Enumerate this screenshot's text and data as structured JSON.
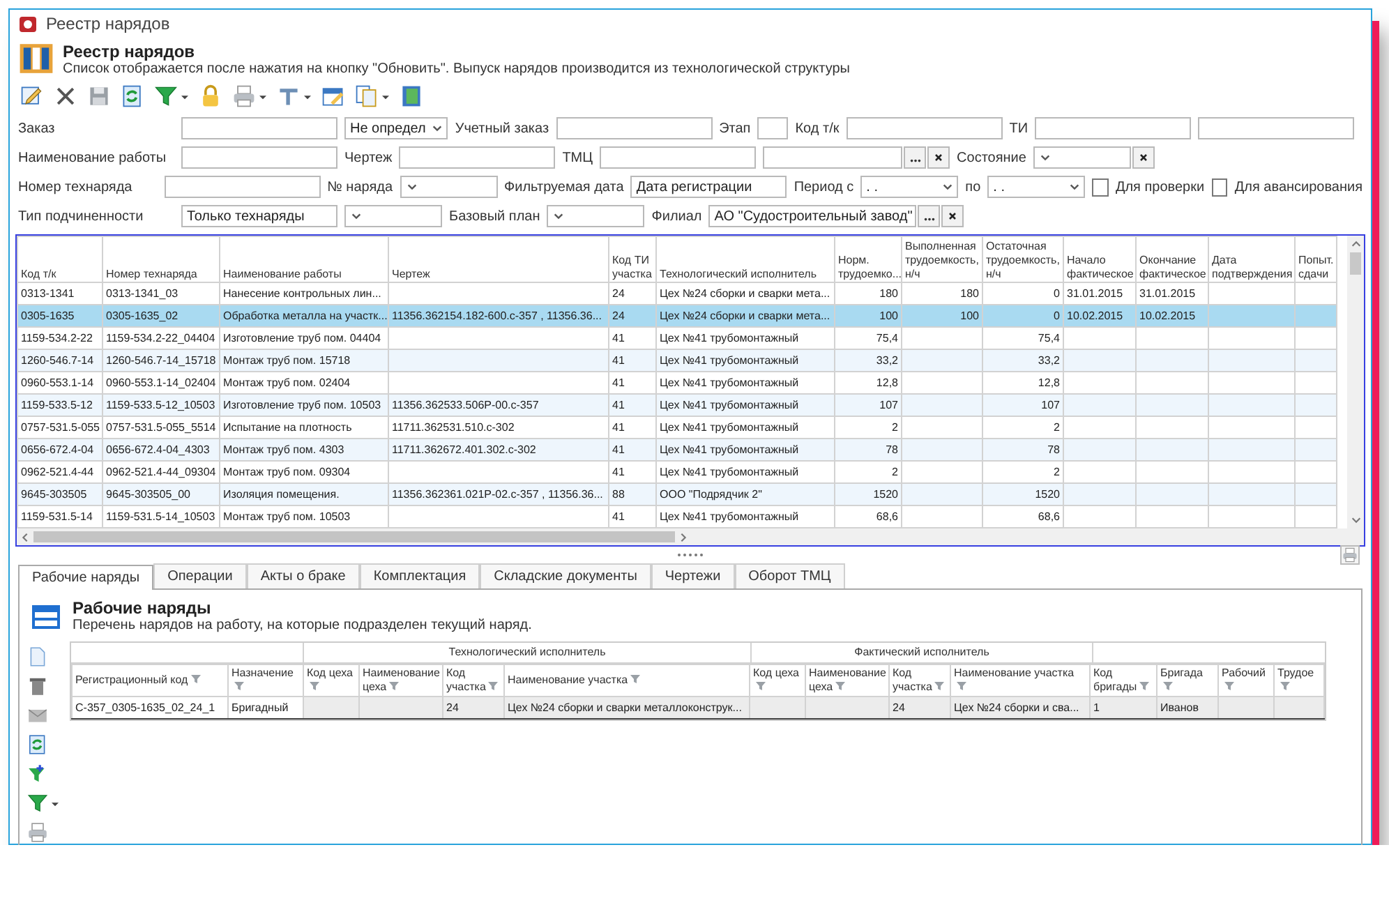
{
  "window": {
    "title": "Реестр нарядов"
  },
  "header": {
    "title": "Реестр нарядов",
    "subtitle": "Список отображается после нажатия на кнопку \"Обновить\". Выпуск нарядов производится из технологической структуры"
  },
  "filters": [
    [
      {
        "kind": "field",
        "label": "Заказ"
      },
      {
        "kind": "combo",
        "value": "Не определ"
      },
      {
        "kind": "field",
        "label": "Учетный заказ"
      },
      {
        "kind": "short",
        "label": "Этап"
      },
      {
        "kind": "field",
        "label": "Код т/к"
      },
      {
        "kind": "field",
        "label": "ТИ"
      },
      {
        "kind": "field"
      }
    ],
    [
      {
        "kind": "field",
        "label": "Наименование работы"
      },
      {
        "kind": "field",
        "label": "Чертеж"
      },
      {
        "kind": "field",
        "label": "ТМЦ"
      },
      {
        "kind": "lookup"
      },
      {
        "kind": "combo-clear",
        "label": "Состояние"
      }
    ],
    [
      {
        "kind": "field",
        "label": "Номер технаряда"
      },
      {
        "kind": "combo",
        "label": "№ наряда"
      },
      {
        "kind": "field",
        "label": "Фильтруемая дата",
        "value": "Дата регистрации"
      },
      {
        "kind": "combo",
        "label": "Период с",
        "value": ". ."
      },
      {
        "kind": "combo",
        "label": "по",
        "value": ". ."
      },
      {
        "kind": "check",
        "label": "Для проверки",
        "checked": false
      },
      {
        "kind": "check",
        "label": "Для авансирования",
        "checked": false
      }
    ],
    [
      {
        "kind": "field",
        "label": "Тип подчиненности",
        "value": "Только технаряды"
      },
      {
        "kind": "combo"
      },
      {
        "kind": "combo",
        "label": "Базовый план"
      },
      {
        "kind": "lookup",
        "label": "Филиал",
        "value": "АО \"Судостроительный завод\""
      }
    ]
  ],
  "grid": {
    "columns": [
      "Код т/к",
      "Номер технаряда",
      "Наименование работы",
      "Чертеж",
      "Код ТИ участка",
      "Технологический исполнитель",
      "Норм. трудоемко...",
      "Выполненная трудоемкость, н/ч",
      "Остаточная трудоемкость, н/ч",
      "Начало фактическое",
      "Окончание фактическое",
      "Дата подтверждения",
      "Попыт. сдачи"
    ],
    "rows": [
      {
        "selected": false,
        "cells": [
          "0313-1341",
          "0313-1341_03",
          "Нанесение контрольных лин...",
          null,
          "24",
          "Цех №24 сборки и сварки мета...",
          "180",
          "180",
          "0",
          "31.01.2015",
          "31.01.2015",
          null,
          null
        ]
      },
      {
        "selected": true,
        "cells": [
          "0305-1635",
          "0305-1635_02",
          "Обработка металла на участк...",
          "11356.362154.182-600.с-357 , 11356.36...",
          "24",
          "Цех №24 сборки и сварки мета...",
          "100",
          "100",
          "0",
          "10.02.2015",
          "10.02.2015",
          null,
          null
        ]
      },
      {
        "selected": false,
        "cells": [
          "1159-534.2-22",
          "1159-534.2-22_04404",
          "Изготовление труб пом. 04404",
          null,
          "41",
          "Цех №41 трубомонтажный",
          "75,4",
          null,
          "75,4",
          null,
          null,
          null,
          null
        ]
      },
      {
        "selected": false,
        "cells": [
          "1260-546.7-14",
          "1260-546.7-14_15718",
          "Монтаж труб пом. 15718",
          null,
          "41",
          "Цех №41 трубомонтажный",
          "33,2",
          null,
          "33,2",
          null,
          null,
          null,
          null
        ]
      },
      {
        "selected": false,
        "cells": [
          "0960-553.1-14",
          "0960-553.1-14_02404",
          "Монтаж труб пом. 02404",
          null,
          "41",
          "Цех №41 трубомонтажный",
          "12,8",
          null,
          "12,8",
          null,
          null,
          null,
          null
        ]
      },
      {
        "selected": false,
        "cells": [
          "1159-533.5-12",
          "1159-533.5-12_10503",
          "Изготовление труб пом. 10503",
          "11356.362533.506Р-00.с-357",
          "41",
          "Цех №41 трубомонтажный",
          "107",
          null,
          "107",
          null,
          null,
          null,
          null
        ]
      },
      {
        "selected": false,
        "cells": [
          "0757-531.5-055",
          "0757-531.5-055_5514",
          "Испытание на плотность",
          "11711.362531.510.с-302",
          "41",
          "Цех №41 трубомонтажный",
          "2",
          null,
          "2",
          null,
          null,
          null,
          null
        ]
      },
      {
        "selected": false,
        "cells": [
          "0656-672.4-04",
          "0656-672.4-04_4303",
          "Монтаж труб пом. 4303",
          "11711.362672.401.302.с-302",
          "41",
          "Цех №41 трубомонтажный",
          "78",
          null,
          "78",
          null,
          null,
          null,
          null
        ]
      },
      {
        "selected": false,
        "cells": [
          "0962-521.4-44",
          "0962-521.4-44_09304",
          "Монтаж труб пом. 09304",
          null,
          "41",
          "Цех №41 трубомонтажный",
          "2",
          null,
          "2",
          null,
          null,
          null,
          null
        ]
      },
      {
        "selected": false,
        "cells": [
          "9645-303505",
          "9645-303505_00",
          "Изоляция помещения.",
          "11356.362361.021Р-02.с-357 , 11356.36...",
          "88",
          "ООО \"Подрядчик 2\"",
          "1520",
          null,
          "1520",
          null,
          null,
          null,
          null
        ]
      },
      {
        "selected": false,
        "cells": [
          "1159-531.5-14",
          "1159-531.5-14_10503",
          "Монтаж труб пом. 10503",
          null,
          "41",
          "Цех №41 трубомонтажный",
          "68,6",
          null,
          "68,6",
          null,
          null,
          null,
          null
        ]
      }
    ]
  },
  "tabs": [
    {
      "label": "Рабочие наряды",
      "selected": true
    },
    {
      "label": "Операции",
      "selected": false
    },
    {
      "label": "Акты о браке",
      "selected": false
    },
    {
      "label": "Комплектация",
      "selected": false
    },
    {
      "label": "Складские документы",
      "selected": false
    },
    {
      "label": "Чертежи",
      "selected": false
    },
    {
      "label": "Оборот ТМЦ",
      "selected": false
    }
  ],
  "panel": {
    "title": "Рабочие наряды",
    "subtitle": "Перечень нарядов на работу, на которые подразделен текущий наряд.",
    "column_groups": [
      {
        "label": "Технологический исполнитель"
      },
      {
        "label": "Фактический исполнитель"
      }
    ],
    "columns": [
      "Регистрационный код",
      "Назначение",
      "Код цеха",
      "Наименование цеха",
      "Код участка",
      "Наименование участка",
      "Код цеха",
      "Наименование цеха",
      "Код участка",
      "Наименование участка",
      "Код бригады",
      "Бригада",
      "Рабочий",
      "Трудое"
    ],
    "rows": [
      {
        "cells": [
          "С-357_0305-1635_02_24_1",
          "Бригадный",
          null,
          null,
          "24",
          "Цех №24 сборки и сварки металлоконструк...",
          null,
          null,
          "24",
          "Цех №24 сборки и сва...",
          "1",
          "Иванов",
          null,
          null
        ]
      }
    ]
  }
}
